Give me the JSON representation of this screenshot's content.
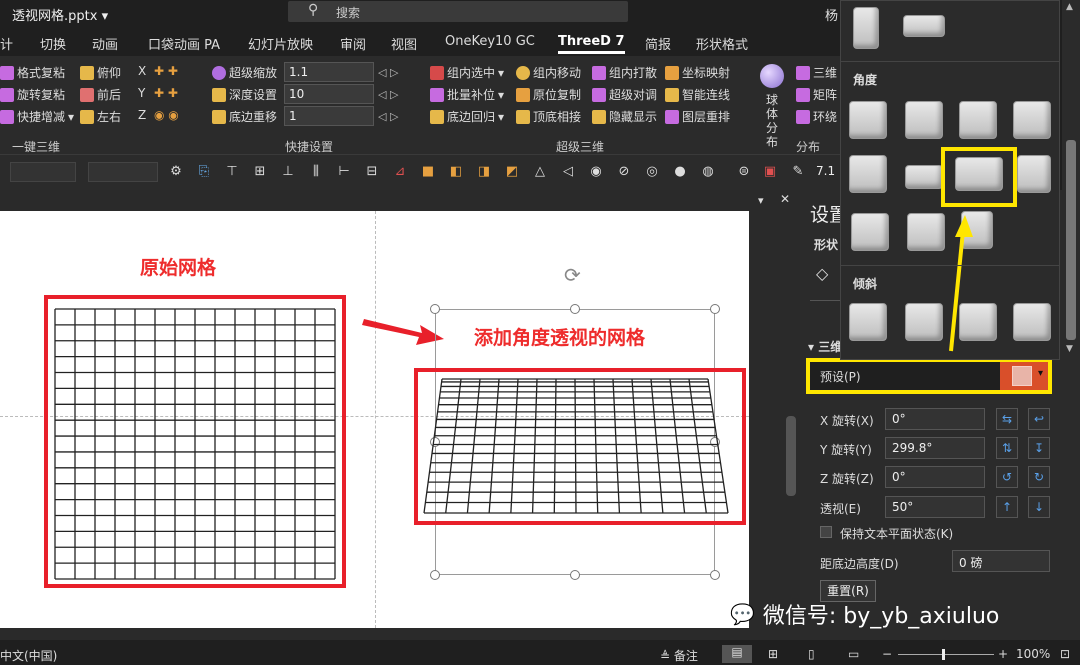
{
  "title_bar": {
    "document": "透视网格.pptx",
    "search_placeholder": "搜索",
    "user": "杨"
  },
  "tabs": [
    "计",
    "切换",
    "动画",
    "口袋动画 PA",
    "幻灯片放映",
    "审阅",
    "视图",
    "OneKey10 GC",
    "ThreeD 7",
    "简报",
    "形状格式"
  ],
  "active_tab": "ThreeD 7",
  "ribbon": {
    "group1": {
      "label": "一键三维",
      "items": [
        "格式复粘",
        "旋转复粘",
        "快捷增减",
        "俯仰",
        "前后",
        "左右"
      ],
      "axes": [
        "X",
        "Y",
        "Z"
      ]
    },
    "group2": {
      "label": "快捷设置",
      "items": [
        "超级缩放",
        "深度设置",
        "底边重移"
      ],
      "values": [
        "1.1",
        "10",
        "1"
      ]
    },
    "group3": {
      "label": "超级三维",
      "items": [
        "组内选中",
        "批量补位",
        "底边回归",
        "组内移动",
        "原位复制",
        "顶底相接",
        "组内打散",
        "超级对调",
        "隐藏显示",
        "坐标映射",
        "智能连线",
        "图层重排"
      ]
    },
    "group4": {
      "label": "分布",
      "items": [
        "球体分布",
        "三维",
        "矩阵",
        "环绕"
      ]
    }
  },
  "toolbar2": {
    "value": "7.1"
  },
  "slide": {
    "left_title": "原始网格",
    "right_title": "添加角度透视的网格",
    "grid_rows": 17,
    "grid_cols": 14
  },
  "dropdown": {
    "section_angle": "角度",
    "section_tilt": "倾斜"
  },
  "format_panel": {
    "title": "设置",
    "subtitle": "形状",
    "section": "三维",
    "preset_label": "预设(P)",
    "fields": [
      {
        "label": "X 旋转(X)",
        "value": "0°"
      },
      {
        "label": "Y 旋转(Y)",
        "value": "299.8°"
      },
      {
        "label": "Z 旋转(Z)",
        "value": "0°"
      },
      {
        "label": "透视(E)",
        "value": "50°"
      }
    ],
    "keep_flat": "保持文本平面状态(K)",
    "distance_label": "距底边高度(D)",
    "distance_value": "0 磅",
    "reset": "重置(R)"
  },
  "status_bar": {
    "language": "中文(中国)",
    "notes": "备注",
    "zoom": "100%"
  },
  "watermark": "微信号: by_yb_axiuluo",
  "colors": {
    "accent_red": "#e8202a",
    "highlight_yellow": "#ffe600",
    "preset_fill": "#d94f2a"
  }
}
